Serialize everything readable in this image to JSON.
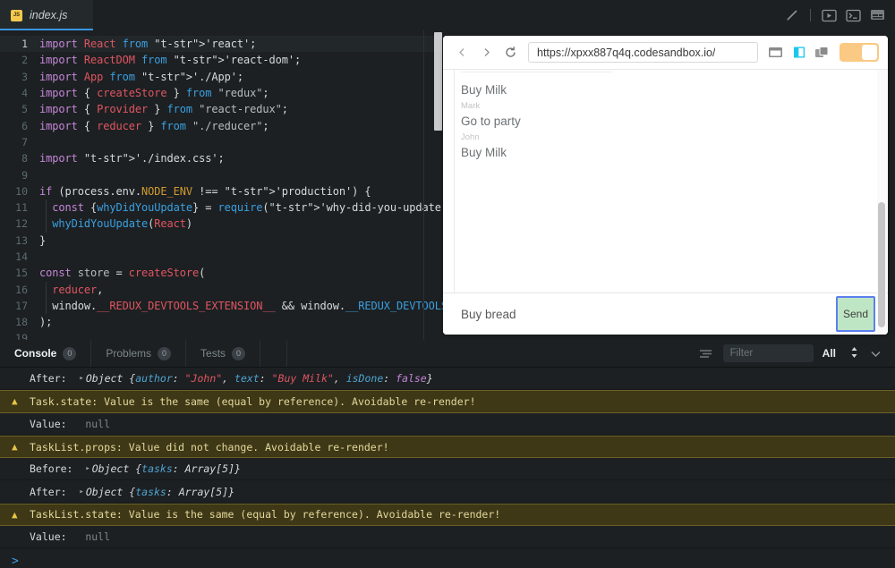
{
  "header": {
    "tab": {
      "label": "index.js",
      "icon": "js-file-icon"
    },
    "actions": [
      {
        "name": "pen-icon",
        "glyph": "pen"
      },
      {
        "name": "preview-icon",
        "glyph": "preview"
      },
      {
        "name": "terminal-icon",
        "glyph": "terminal"
      },
      {
        "name": "console-panel-icon",
        "glyph": "console"
      }
    ]
  },
  "editor": {
    "lines": [
      {
        "n": "1",
        "active": true
      },
      {
        "n": "2",
        "active": false
      },
      {
        "n": "3",
        "active": false
      },
      {
        "n": "4",
        "active": false
      },
      {
        "n": "5",
        "active": false
      },
      {
        "n": "6",
        "active": false
      },
      {
        "n": "7",
        "active": false
      },
      {
        "n": "8",
        "active": false
      },
      {
        "n": "9",
        "active": false
      },
      {
        "n": "10",
        "active": false
      },
      {
        "n": "11",
        "active": false
      },
      {
        "n": "12",
        "active": false
      },
      {
        "n": "13",
        "active": false
      },
      {
        "n": "14",
        "active": false
      },
      {
        "n": "15",
        "active": false
      },
      {
        "n": "16",
        "active": false
      },
      {
        "n": "17",
        "active": false
      },
      {
        "n": "18",
        "active": false
      },
      {
        "n": "19",
        "active": false
      }
    ],
    "code": [
      "import React from 'react';",
      "import ReactDOM from 'react-dom';",
      "import App from './App';",
      "import { createStore } from \"redux\";",
      "import { Provider } from \"react-redux\";",
      "import { reducer } from \"./reducer\";",
      "",
      "import './index.css';",
      "",
      "if (process.env.NODE_ENV !== 'production') {",
      "  const {whyDidYouUpdate} = require('why-did-you-update')",
      "  whyDidYouUpdate(React)",
      "}",
      "",
      "const store = createStore(",
      "  reducer,",
      "  window.__REDUX_DEVTOOLS_EXTENSION__ && window.__REDUX_DEVTOOLS_",
      ");",
      ""
    ]
  },
  "browser": {
    "url": "https://xpxx887q4q.codesandbox.io/",
    "back_icon": "chevron-left-icon",
    "forward_icon": "chevron-right-icon",
    "reload_icon": "reload-icon",
    "layout_icons": [
      {
        "name": "browser-view-icon",
        "color": "#8a8a8a",
        "active": false
      },
      {
        "name": "responsive-view-icon",
        "color": "#18c8f0",
        "active": true
      },
      {
        "name": "duplicate-view-icon",
        "color": "#8a8a8a",
        "active": false
      }
    ],
    "toggle": {
      "name": "preview-toggle",
      "on": true,
      "color": "#fac983"
    }
  },
  "app": {
    "tasks": [
      {
        "author": "",
        "text": "Buy Milk"
      },
      {
        "author": "Mark",
        "text": "Go to party"
      },
      {
        "author": "John",
        "text": "Buy Milk"
      }
    ],
    "input_value": "Buy bread",
    "send_label": "Send"
  },
  "console": {
    "tabs": [
      {
        "label": "Console",
        "badge": "0",
        "active": true
      },
      {
        "label": "Problems",
        "badge": "0",
        "active": false
      },
      {
        "label": "Tests",
        "badge": "0",
        "active": false
      }
    ],
    "clear_icon": "clear-lines-icon",
    "filter_placeholder": "Filter",
    "level_value": "All",
    "stepper_icon": "stepper-icon",
    "chevron_icon": "chevron-down-icon",
    "prompt": ">",
    "rows": [
      {
        "type": "object",
        "label": "After:",
        "expander": "▸",
        "obj": "Object ",
        "parts": [
          {
            "t": "brace",
            "v": "{"
          },
          {
            "t": "key",
            "v": "author"
          },
          {
            "t": "brace",
            "v": ": "
          },
          {
            "t": "str",
            "v": "\"John\""
          },
          {
            "t": "brace",
            "v": ", "
          },
          {
            "t": "key",
            "v": "text"
          },
          {
            "t": "brace",
            "v": ": "
          },
          {
            "t": "str",
            "v": "\"Buy Milk\""
          },
          {
            "t": "brace",
            "v": ", "
          },
          {
            "t": "key",
            "v": "isDone"
          },
          {
            "t": "brace",
            "v": ": "
          },
          {
            "t": "bool",
            "v": "false"
          },
          {
            "t": "brace",
            "v": "}"
          }
        ]
      },
      {
        "type": "warn",
        "icon": "warning-icon",
        "text": "Task.state: Value is the same (equal by reference). Avoidable re-render!"
      },
      {
        "type": "value",
        "label": "Value:",
        "value": "null"
      },
      {
        "type": "warn",
        "icon": "warning-icon",
        "text": "TaskList.props: Value did not change. Avoidable re-render!"
      },
      {
        "type": "object",
        "label": "Before:",
        "expander": "▸",
        "obj": "Object ",
        "parts": [
          {
            "t": "brace",
            "v": "{"
          },
          {
            "t": "key",
            "v": "tasks"
          },
          {
            "t": "brace",
            "v": ": Array[5]}"
          }
        ]
      },
      {
        "type": "object",
        "label": "After:",
        "expander": "▸",
        "obj": "Object ",
        "parts": [
          {
            "t": "brace",
            "v": "{"
          },
          {
            "t": "key",
            "v": "tasks"
          },
          {
            "t": "brace",
            "v": ": Array[5]}"
          }
        ]
      },
      {
        "type": "warn",
        "icon": "warning-icon",
        "text": "TaskList.state: Value is the same (equal by reference). Avoidable re-render!"
      },
      {
        "type": "value",
        "label": "Value:",
        "value": "null"
      }
    ]
  }
}
